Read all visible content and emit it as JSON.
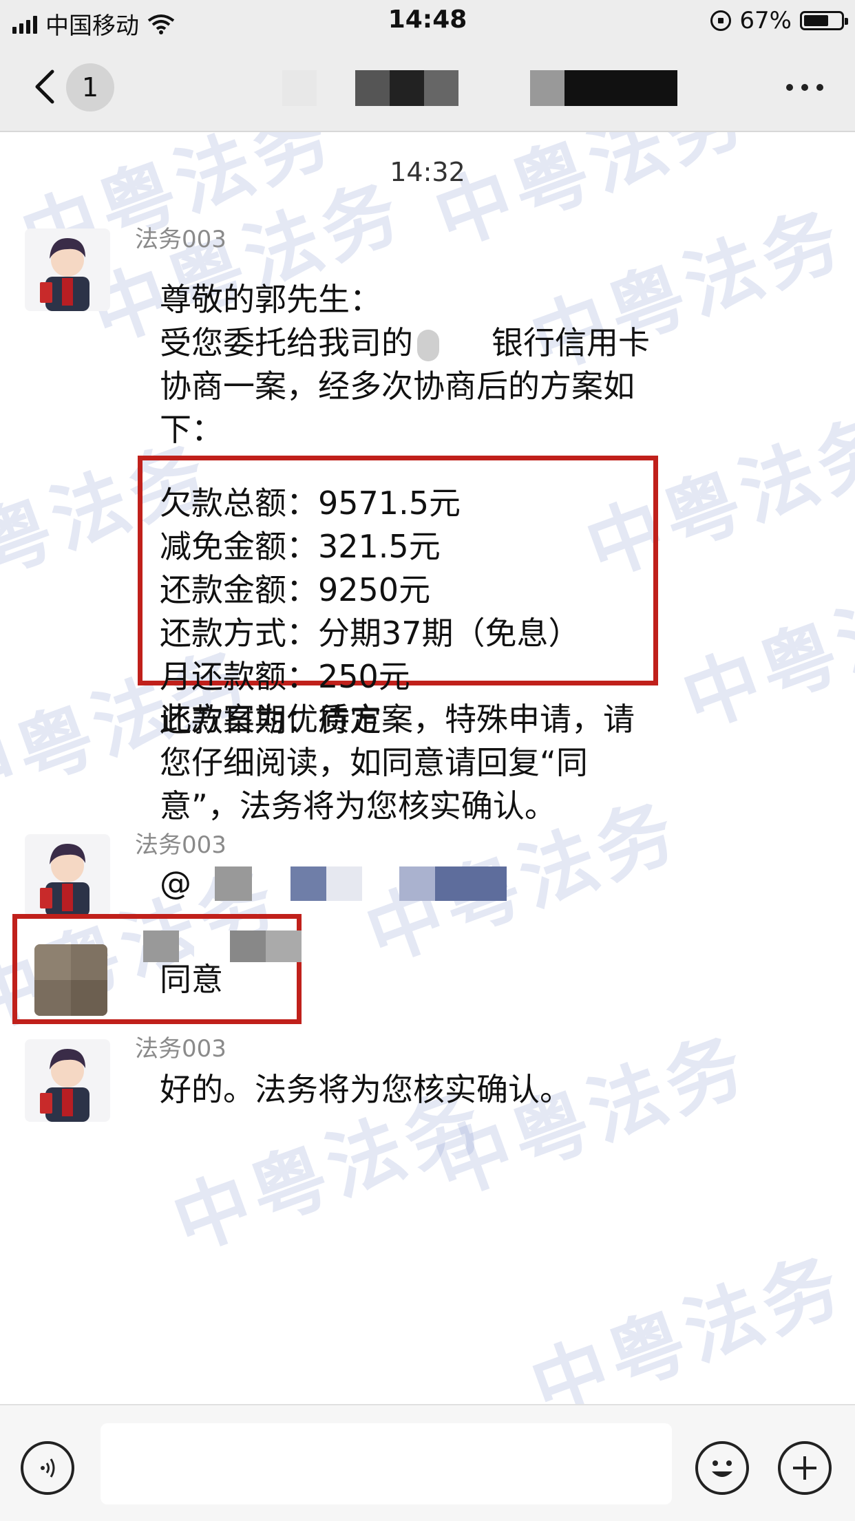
{
  "status_bar": {
    "carrier": "中国移动",
    "time": "14:48",
    "battery": "67%",
    "battery_level": 0.67
  },
  "nav": {
    "unread_count": "1"
  },
  "chat": {
    "timestamp": "14:32",
    "watermark": "中粤法务",
    "messages": [
      {
        "sender": "法务003",
        "greeting": "尊敬的郭先生：",
        "intro_a": "受您委托给我司的",
        "intro_b": "银行信用卡",
        "intro_c": "协商一案，经多次协商后的方案如",
        "intro_d": "下：",
        "plan": [
          {
            "label": "欠款总额：",
            "value": "9571.5元"
          },
          {
            "label": "减免金额：",
            "value": "321.5元"
          },
          {
            "label": "还款金额：",
            "value": "9250元"
          },
          {
            "label": "还款方式：",
            "value": "分期37期（免息）"
          },
          {
            "label": "月还款额：",
            "value": "250元"
          },
          {
            "label": "还款日期：",
            "value": "待定"
          }
        ],
        "note_1": "此方案为优质方案，特殊申请，请",
        "note_2": "您仔细阅读，如同意请回复“同",
        "note_3": "意”，法务将为您核实确认。"
      },
      {
        "sender": "法务003",
        "text": "@"
      },
      {
        "text": "同意"
      },
      {
        "sender": "法务003",
        "text": "好的。法务将为您核实确认。"
      }
    ]
  }
}
